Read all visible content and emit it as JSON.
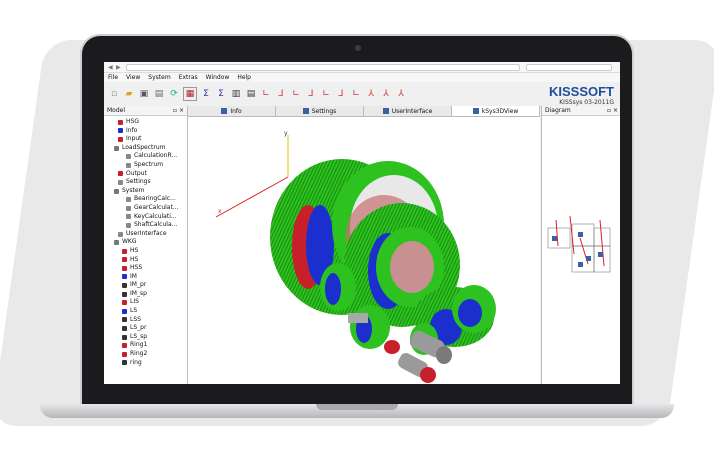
{
  "menu": [
    "File",
    "View",
    "System",
    "Extras",
    "Window",
    "Help"
  ],
  "brand": {
    "logo": "KISSSOFT",
    "version": "KISSsys 03-2011G"
  },
  "model_panel": {
    "title": "Model"
  },
  "diagram_panel": {
    "title": "Diagram"
  },
  "tabs": [
    "Info",
    "Settings",
    "UserInterface",
    "kSys3DView"
  ],
  "tree": [
    {
      "label": "HSG",
      "icon": "gear-red"
    },
    {
      "label": "Info",
      "icon": "info"
    },
    {
      "label": "Input",
      "icon": "gear-red"
    },
    {
      "label": "LoadSpectrum",
      "icon": "folder"
    },
    {
      "label": "CalculationR...",
      "icon": "doc"
    },
    {
      "label": "Spectrum",
      "icon": "doc"
    },
    {
      "label": "Output",
      "icon": "gear-red"
    },
    {
      "label": "Settings",
      "icon": "doc"
    },
    {
      "label": "System",
      "icon": "folder"
    },
    {
      "label": "BearingCalc...",
      "icon": "doc"
    },
    {
      "label": "GearCalculat...",
      "icon": "doc"
    },
    {
      "label": "KeyCalculati...",
      "icon": "doc"
    },
    {
      "label": "ShaftCalcula...",
      "icon": "doc"
    },
    {
      "label": "UserInterface",
      "icon": "doc"
    },
    {
      "label": "WKG",
      "icon": "folder"
    },
    {
      "label": "HS",
      "icon": "arrow"
    },
    {
      "label": "HS",
      "icon": "arrow"
    },
    {
      "label": "HSS",
      "icon": "arrow"
    },
    {
      "label": "IM",
      "icon": "gear-blue"
    },
    {
      "label": "IM_pr",
      "icon": "shaft"
    },
    {
      "label": "IM_sp",
      "icon": "shaft"
    },
    {
      "label": "LIS",
      "icon": "arrow"
    },
    {
      "label": "LS",
      "icon": "gear-blue"
    },
    {
      "label": "LSS",
      "icon": "shaft"
    },
    {
      "label": "LS_pr",
      "icon": "shaft"
    },
    {
      "label": "LS_sp",
      "icon": "shaft"
    },
    {
      "label": "Ring1",
      "icon": "arrow"
    },
    {
      "label": "Ring2",
      "icon": "arrow"
    },
    {
      "label": "ring",
      "icon": "shaft"
    }
  ],
  "colors": {
    "gear_green": "#2dc21f",
    "gear_blue": "#1b2fcf",
    "gear_red": "#c8202a",
    "shaft": "#9a9a9a",
    "brand_blue": "#1f4ea0"
  }
}
